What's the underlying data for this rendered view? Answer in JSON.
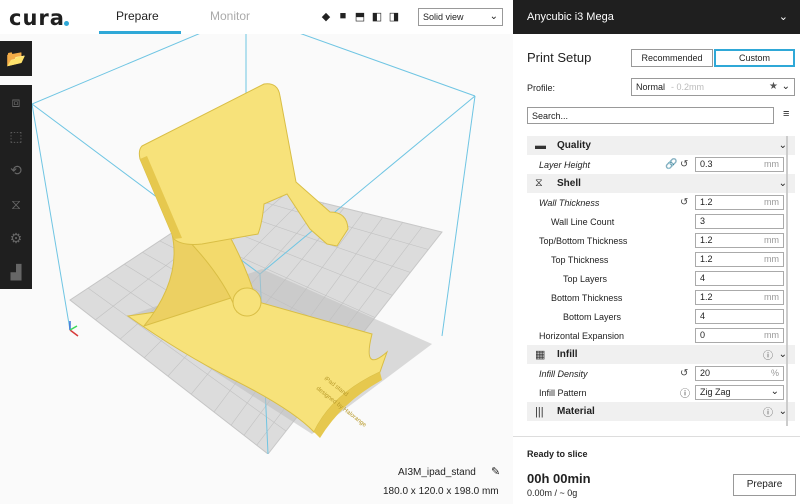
{
  "app": {
    "logo": "cura",
    "tabs": [
      {
        "label": "Prepare"
      },
      {
        "label": "Monitor"
      }
    ],
    "view_select": "Solid view",
    "view_icons": [
      "3d-view-icon",
      "front-view-icon",
      "top-view-icon",
      "left-view-icon",
      "right-view-icon"
    ]
  },
  "printer": {
    "name": "Anycubic i3 Mega"
  },
  "print_setup": {
    "title": "Print Setup",
    "recommended_label": "Recommended",
    "custom_label": "Custom",
    "profile_label": "Profile:",
    "profile_value": "Normal",
    "profile_sub": "- 0.2mm",
    "search_placeholder": "Search..."
  },
  "settings": {
    "quality": {
      "label": "Quality"
    },
    "layer_height": {
      "label": "Layer Height",
      "value": "0.3",
      "unit": "mm"
    },
    "shell": {
      "label": "Shell"
    },
    "wall_thickness": {
      "label": "Wall Thickness",
      "value": "1.2",
      "unit": "mm"
    },
    "wall_line_count": {
      "label": "Wall Line Count",
      "value": "3"
    },
    "top_bottom_thickness": {
      "label": "Top/Bottom Thickness",
      "value": "1.2",
      "unit": "mm"
    },
    "top_thickness": {
      "label": "Top Thickness",
      "value": "1.2",
      "unit": "mm"
    },
    "top_layers": {
      "label": "Top Layers",
      "value": "4"
    },
    "bottom_thickness": {
      "label": "Bottom Thickness",
      "value": "1.2",
      "unit": "mm"
    },
    "bottom_layers": {
      "label": "Bottom Layers",
      "value": "4"
    },
    "horizontal_expansion": {
      "label": "Horizontal Expansion",
      "value": "0",
      "unit": "mm"
    },
    "infill": {
      "label": "Infill"
    },
    "infill_density": {
      "label": "Infill Density",
      "value": "20",
      "unit": "%"
    },
    "infill_pattern": {
      "label": "Infill Pattern",
      "value": "Zig Zag"
    },
    "material": {
      "label": "Material"
    }
  },
  "object": {
    "name": "AI3M_ipad_stand",
    "dimensions": "180.0 x 120.0 x 198.0 mm",
    "engraving_line1": "iPad stand",
    "engraving_line2": "designed by Halorange"
  },
  "slice": {
    "status": "Ready to slice",
    "time": "00h 00min",
    "material": "0.00m / ~ 0g",
    "button": "Prepare"
  },
  "colors": {
    "accent": "#2fa8d7",
    "model": "#f7e27a",
    "dark": "#1f1f1f"
  }
}
